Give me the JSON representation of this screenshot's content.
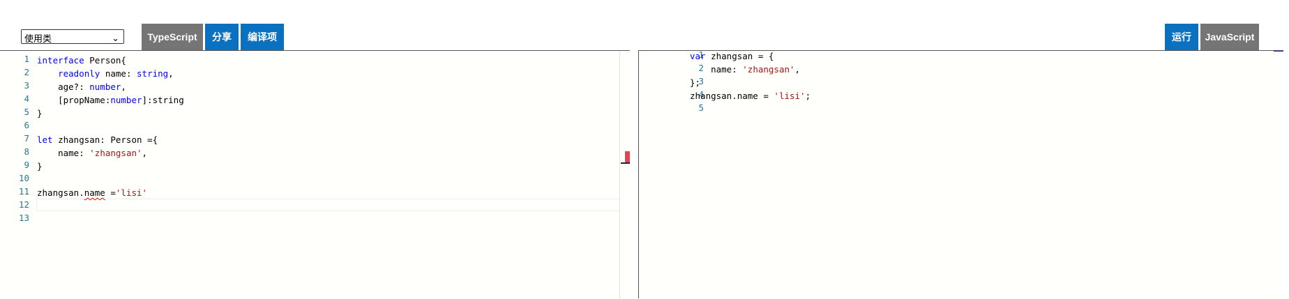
{
  "toolbar": {
    "class_select": {
      "value": "使用类",
      "caret": "⌄"
    },
    "typescript_label": "TypeScript",
    "share_label": "分享",
    "compile_options_label": "编译项",
    "run_label": "运行",
    "javascript_label": "JavaScript"
  },
  "colors": {
    "tab_gray": "#757575",
    "tab_blue": "#0a70c0",
    "keyword": "#0000ff",
    "string": "#a31515",
    "line_number": "#237893",
    "error": "#e04848"
  },
  "editor_ts": {
    "lines": [
      {
        "n": "1",
        "parts": [
          "interface",
          " Person{"
        ]
      },
      {
        "n": "2",
        "parts": [
          "    ",
          "readonly",
          " name: ",
          "string",
          ","
        ]
      },
      {
        "n": "3",
        "parts": [
          "    age?: ",
          "number",
          ","
        ]
      },
      {
        "n": "4",
        "parts": [
          "    [propName:",
          "number",
          "]:string"
        ]
      },
      {
        "n": "5",
        "parts": [
          "}"
        ]
      },
      {
        "n": "6",
        "parts": [
          ""
        ]
      },
      {
        "n": "7",
        "parts": [
          "let",
          " zhangsan: Person ={"
        ]
      },
      {
        "n": "8",
        "parts": [
          "    name: ",
          "'zhangsan'",
          ","
        ]
      },
      {
        "n": "9",
        "parts": [
          "}"
        ]
      },
      {
        "n": "10",
        "parts": [
          ""
        ]
      },
      {
        "n": "11",
        "parts": [
          "zhangsan.",
          "name",
          " =",
          "'lisi'"
        ]
      },
      {
        "n": "12",
        "parts": [
          ""
        ]
      },
      {
        "n": "13",
        "parts": [
          ""
        ]
      }
    ]
  },
  "editor_js": {
    "lines": [
      {
        "n": "1",
        "parts": [
          "var",
          " zhangsan = {"
        ]
      },
      {
        "n": "2",
        "parts": [
          "    name: ",
          "'zhangsan'",
          ","
        ]
      },
      {
        "n": "3",
        "parts": [
          "};"
        ]
      },
      {
        "n": "4",
        "parts": [
          "zhangsan.name = ",
          "'lisi'",
          ";"
        ]
      },
      {
        "n": "5",
        "parts": [
          ""
        ]
      }
    ]
  }
}
